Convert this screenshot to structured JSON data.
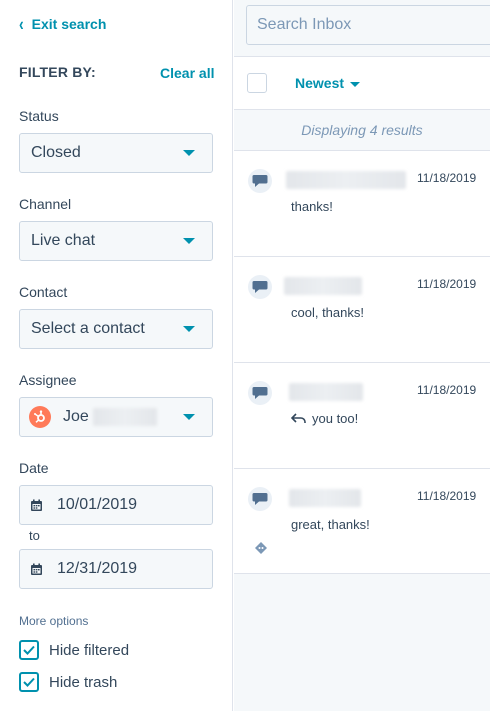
{
  "filters": {
    "exit_search": "Exit search",
    "filter_by": "FILTER BY:",
    "clear_all": "Clear all",
    "status": {
      "label": "Status",
      "value": "Closed"
    },
    "channel": {
      "label": "Channel",
      "value": "Live chat"
    },
    "contact": {
      "label": "Contact",
      "value": "Select a contact"
    },
    "assignee": {
      "label": "Assignee",
      "value": "Joe"
    },
    "date": {
      "label": "Date",
      "from": "10/01/2019",
      "to_label": "to",
      "to": "12/31/2019"
    },
    "more_options": "More options",
    "hide_filtered": {
      "label": "Hide filtered",
      "checked": true
    },
    "hide_trash": {
      "label": "Hide trash",
      "checked": true
    }
  },
  "inbox": {
    "search_placeholder": "Search Inbox",
    "sort_label": "Newest",
    "results_text": "Displaying 4 results",
    "conversations": [
      {
        "date": "11/18/2019",
        "snippet": "thanks!",
        "reply": false
      },
      {
        "date": "11/18/2019",
        "snippet": "cool, thanks!",
        "reply": false
      },
      {
        "date": "11/18/2019",
        "snippet": "you too!",
        "reply": true
      },
      {
        "date": "11/18/2019",
        "snippet": "great, thanks!",
        "reply": false
      }
    ]
  },
  "colors": {
    "accent": "#0091ae",
    "text": "#33475b",
    "avatar": "#ff7a59"
  }
}
